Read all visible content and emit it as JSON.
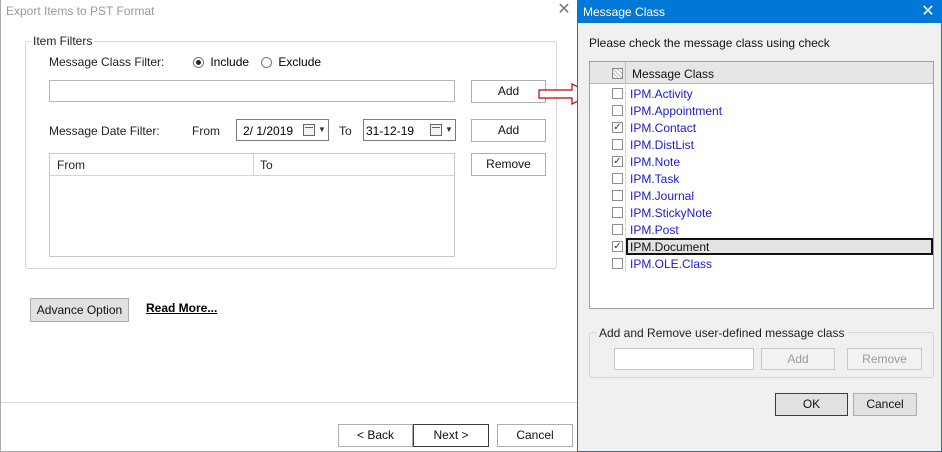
{
  "main_dialog": {
    "title": "Export Items to PST Format",
    "close_glyph": "✕",
    "item_filters_legend": "Item Filters",
    "message_class_filter_label": "Message Class Filter:",
    "include_label": "Include",
    "exclude_label": "Exclude",
    "selected_mode": "Include",
    "class_input_value": "",
    "add_class_button": "Add",
    "message_date_filter_label": "Message Date Filter:",
    "from_label": "From",
    "from_date": "2/  1/2019",
    "to_label": "To",
    "to_date": "31-12-19",
    "add_date_button": "Add",
    "remove_button": "Remove",
    "date_list_columns": [
      "From",
      "To"
    ],
    "advance_option_button": "Advance Option",
    "read_more_link": "Read More...",
    "back_button": "< Back",
    "next_button": "Next >",
    "cancel_button": "Cancel"
  },
  "message_class_dialog": {
    "title": "Message Class",
    "close_glyph": "✕",
    "instruction": "Please check the message class using check",
    "column_header": "Message Class",
    "items": [
      {
        "name": "IPM.Activity",
        "checked": false,
        "selected": false
      },
      {
        "name": "IPM.Appointment",
        "checked": false,
        "selected": false
      },
      {
        "name": "IPM.Contact",
        "checked": true,
        "selected": false
      },
      {
        "name": "IPM.DistList",
        "checked": false,
        "selected": false
      },
      {
        "name": "IPM.Note",
        "checked": true,
        "selected": false
      },
      {
        "name": "IPM.Task",
        "checked": false,
        "selected": false
      },
      {
        "name": "IPM.Journal",
        "checked": false,
        "selected": false
      },
      {
        "name": "IPM.StickyNote",
        "checked": false,
        "selected": false
      },
      {
        "name": "IPM.Post",
        "checked": false,
        "selected": false
      },
      {
        "name": "IPM.Document",
        "checked": true,
        "selected": true
      },
      {
        "name": "IPM.OLE.Class",
        "checked": false,
        "selected": false
      }
    ],
    "user_defined_legend": "Add and Remove user-defined message class",
    "user_defined_input_value": "",
    "add_button": "Add",
    "remove_button": "Remove",
    "ok_button": "OK",
    "cancel_button": "Cancel"
  },
  "colors": {
    "title_bar": "#0078d7",
    "class_link_text": "#1a1ad0",
    "arrow_outline": "#c00000"
  }
}
